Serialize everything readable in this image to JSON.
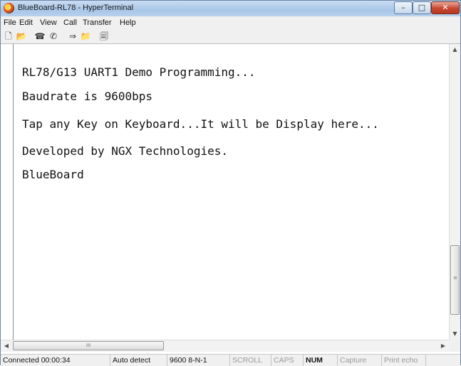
{
  "window": {
    "title": "BlueBoard-RL78 - HyperTerminal",
    "controls": {
      "minimize": "–",
      "maximize": "□",
      "close": "✕"
    }
  },
  "menu": [
    "File",
    "Edit",
    "View",
    "Call",
    "Transfer",
    "Help"
  ],
  "toolbar": {
    "icons": [
      "new-document-icon",
      "open-folder-icon",
      "phone-icon",
      "disconnect-icon",
      "send-icon",
      "receive-icon",
      "properties-icon"
    ],
    "glyphs": [
      "🗋",
      "📂",
      "☎",
      "✆",
      "⇒",
      "📁",
      "🗐"
    ]
  },
  "terminal": {
    "lines": [
      "RL78/G13 UART1 Demo Programming...",
      "Baudrate is 9600bps",
      "Tap any Key on Keyboard...It will be Display here...",
      "Developed by NGX Technologies.",
      "BlueBoard"
    ]
  },
  "scrollbars": {
    "up": "▲",
    "down": "▼",
    "left": "◀",
    "right": "▶",
    "h_grip": "III",
    "v_grip": "≡"
  },
  "statusbar": {
    "connected": "Connected 00:00:34",
    "detect": "Auto detect",
    "settings": "9600 8-N-1",
    "scroll": "SCROLL",
    "caps": "CAPS",
    "num": "NUM",
    "capture": "Capture",
    "print_echo": "Print echo"
  }
}
